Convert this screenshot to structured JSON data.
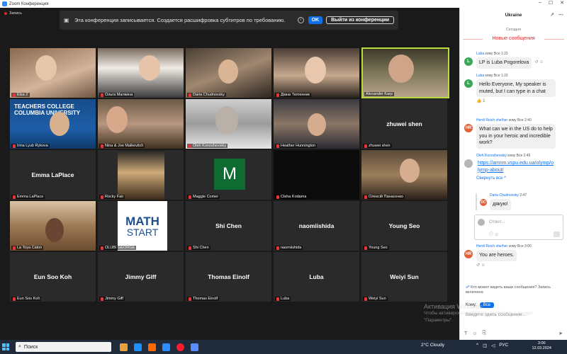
{
  "window": {
    "title": "Zoom Конференция"
  },
  "recording": {
    "label": "Запись"
  },
  "banner": {
    "text": "Эта конференция записывается. Создается расшифровка субтитров по требованию.",
    "ok_label": "OK",
    "leave_label": "Выйти из конференции"
  },
  "participants": [
    {
      "name": "Elsa Z",
      "kind": "video"
    },
    {
      "name": "Ольга Малкина",
      "kind": "video"
    },
    {
      "name": "Daria Chudnovsky",
      "kind": "video"
    },
    {
      "name": "Діана Тютюнник",
      "kind": "video"
    },
    {
      "name": "Alexander Karp",
      "kind": "video",
      "active": true
    },
    {
      "name": "Irina Lyub Rykova",
      "kind": "video"
    },
    {
      "name": "Nina & Joe Malkevitch",
      "kind": "video"
    },
    {
      "name": "Oleh Konoshevskiy",
      "kind": "video"
    },
    {
      "name": "Heather Hunnington",
      "kind": "video"
    },
    {
      "name": "zhuwei shen",
      "kind": "name"
    },
    {
      "name": "Emma LaPlace",
      "kind": "name"
    },
    {
      "name": "Rocky Fair",
      "kind": "video"
    },
    {
      "name": "Maggie Comer",
      "kind": "avatar",
      "initial": "M"
    },
    {
      "name": "Cleha Kodama",
      "kind": "dark"
    },
    {
      "name": "Олексій Панасенко",
      "kind": "video"
    },
    {
      "name": "La Toya Caton",
      "kind": "video"
    },
    {
      "name": "OLUBI GEORGE",
      "kind": "logo"
    },
    {
      "name": "Shi Chen",
      "kind": "name"
    },
    {
      "name": "naomiishida",
      "kind": "name"
    },
    {
      "name": "Young  Seo",
      "kind": "name"
    },
    {
      "name": "Eun Soo Koh",
      "kind": "name"
    },
    {
      "name": "Jimmy Giff",
      "kind": "name"
    },
    {
      "name": "Thomas Einolf",
      "kind": "name"
    },
    {
      "name": "Luba",
      "kind": "name"
    },
    {
      "name": "Weiyi Sun",
      "kind": "name"
    }
  ],
  "tiles_text": {
    "teachers_college": "TEACHERS COLLEGE\nCOLUMBIA UNIVERSITY",
    "math": "MATH",
    "start": "START"
  },
  "chat": {
    "title": "Ukraine",
    "date": "Сегодня",
    "new_messages": "Новые сообщения",
    "messages": [
      {
        "sender": "Luba",
        "to": "кому Все",
        "time": "1:22",
        "avatar": "L",
        "avatar_color": "#3aa757",
        "text": "LP is Luba Pogorelova"
      },
      {
        "sender": "Luba",
        "to": "кому Все",
        "time": "1:22",
        "avatar": "L",
        "avatar_color": "#3aa757",
        "text": "Hello Everyone, My speaker is muted, but I can type in a chat",
        "reaction": "👍 1"
      },
      {
        "sender": "Herdi Reich she/her",
        "to": "кому Все",
        "time": "2:40",
        "avatar": "HR",
        "avatar_color": "#e0613a",
        "text": "What can we in the US do to help you in your heroic and incredible work?"
      },
      {
        "sender": "Oleh Konoshevskiy",
        "to": "кому Все",
        "time": "2:46",
        "avatar": "",
        "avatar_color": "#b6b6b6",
        "link": "https://amnm.vspu.edu.ua/olymp/olymp-about/"
      },
      {
        "sender": "Herdi Reich she/her",
        "to": "кому Все",
        "time": "3:00",
        "avatar": "HR",
        "avatar_color": "#e0613a",
        "text": "You are heroes."
      }
    ],
    "thread_toggle": "Свернуть все ^",
    "thread_reply": {
      "sender": "Daria Chudnovsky",
      "time": "2:47",
      "avatar": "DC",
      "avatar_color": "#e0613a",
      "text": "дякую!"
    },
    "reply_placeholder": "Ответ...",
    "who_sees": "Кто может видеть ваши сообщения? Запись включена",
    "to_label": "Кому:",
    "to_value": "Все",
    "input_placeholder": "Введите здесь сообщение..."
  },
  "watermark": {
    "line1": "Активация Windows",
    "line2": "Чтобы активировать Windows, перейдите в раздел",
    "line3": "\"Параметры\"."
  },
  "taskbar": {
    "search_label": "Поиск",
    "weather": "2°C  Cloudy",
    "lang": "РУС",
    "time": "3:00",
    "date": "12.03.2024"
  }
}
